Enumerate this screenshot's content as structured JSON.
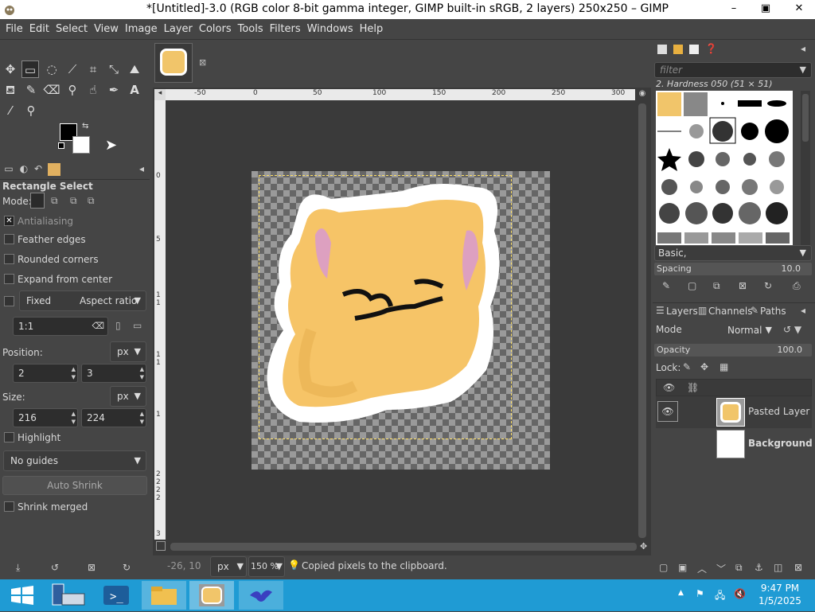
{
  "window": {
    "title": "*[Untitled]-3.0 (RGB color 8-bit gamma integer, GIMP built-in sRGB, 2 layers) 250x250 – GIMP",
    "minimize": "–",
    "maximize": "▣",
    "close": "✕"
  },
  "menu": [
    "File",
    "Edit",
    "Select",
    "View",
    "Image",
    "Layer",
    "Colors",
    "Tools",
    "Filters",
    "Windows",
    "Help"
  ],
  "tool_options": {
    "title": "Rectangle Select",
    "mode_label": "Mode:",
    "antialiasing": "Antialiasing",
    "feather_edges": "Feather edges",
    "rounded_corners": "Rounded corners",
    "expand_from_center": "Expand from center",
    "fixed": "Fixed",
    "aspect_ratio": "Aspect ratio",
    "ratio_value": "1:1",
    "position_label": "Position:",
    "position_unit": "px",
    "pos_x": "2",
    "pos_y": "3",
    "size_label": "Size:",
    "size_unit": "px",
    "size_w": "216",
    "size_h": "224",
    "highlight": "Highlight",
    "guides": "No guides",
    "auto_shrink": "Auto Shrink",
    "shrink_merged": "Shrink merged"
  },
  "ruler": {
    "h_ticks": [
      "-50",
      "0",
      "50",
      "100",
      "150",
      "200",
      "250",
      "300"
    ],
    "v_ticks": [
      "0",
      "5",
      "1",
      "1",
      "1",
      "1",
      "1",
      "2",
      "2",
      "2",
      "2",
      "3"
    ]
  },
  "status": {
    "coords": "-26, 10",
    "unit": "px",
    "zoom": "150 %",
    "message": "Copied pixels to the clipboard."
  },
  "brushes": {
    "filter_placeholder": "filter",
    "current": "2. Hardness 050 (51 × 51)",
    "preset": "Basic,",
    "spacing_label": "Spacing",
    "spacing_value": "10.0"
  },
  "layers": {
    "tabs": [
      "Layers",
      "Channels",
      "Paths"
    ],
    "mode_label": "Mode",
    "mode_value": "Normal",
    "opacity_label": "Opacity",
    "opacity_value": "100.0",
    "lock_label": "Lock:",
    "items": [
      {
        "name": "Pasted Layer"
      },
      {
        "name": "Background"
      }
    ]
  },
  "taskbar": {
    "time": "9:47 PM",
    "date": "1/5/2025"
  }
}
